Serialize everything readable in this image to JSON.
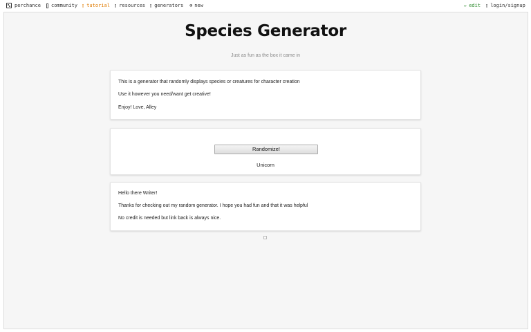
{
  "nav": {
    "brand": "perchance",
    "community": "community",
    "tutorial": "tutorial",
    "resources": "resources",
    "generators": "generators",
    "new": "new",
    "edit": "edit",
    "login": "login/signup",
    "colors": {
      "tutorial": "#e07b00",
      "edit": "#2e8b2e"
    }
  },
  "header": {
    "title": "Species Generator",
    "subtitle": "Just as fun as the box it came in"
  },
  "intro": {
    "lines": [
      "This is a generator that randomly displays species or creatures for character creation",
      "Use it however you need/want get creative!",
      "Enjoy! Love, Alley"
    ]
  },
  "generator": {
    "button_label": "Randomize!",
    "result": "Unicorn"
  },
  "outro": {
    "lines": [
      "Hello there Writer!",
      "Thanks for checking out my random generator. I hope you had fun and that it was helpful",
      "No credit is needed but link back is always nice."
    ]
  }
}
